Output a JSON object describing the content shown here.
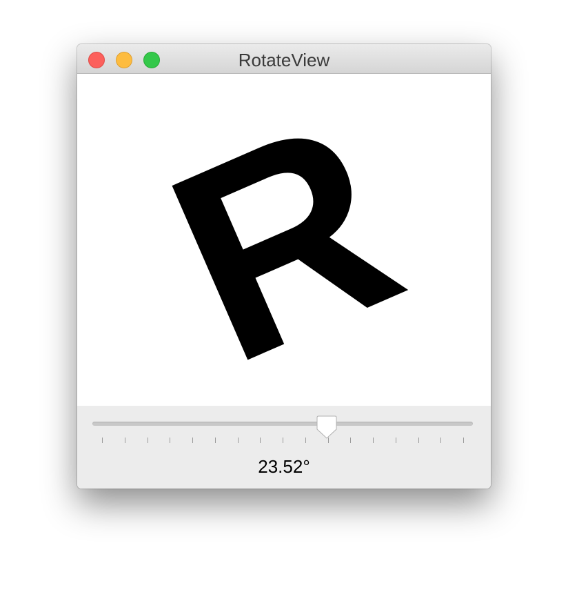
{
  "window": {
    "title": "RotateView"
  },
  "canvas": {
    "glyph": "R"
  },
  "rotation": {
    "min_degrees": -180,
    "max_degrees": 180,
    "value_degrees": 23.52,
    "value_label": "23.52°",
    "tick_count": 17
  },
  "colors": {
    "close": "#fc605c",
    "minimize": "#fdbc40",
    "zoom": "#34c84a"
  },
  "icons": {
    "close": "close-traffic-light",
    "minimize": "minimize-traffic-light",
    "zoom": "zoom-traffic-light"
  }
}
